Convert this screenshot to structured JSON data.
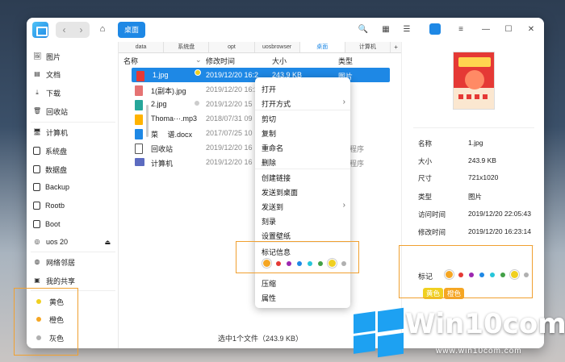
{
  "titlebar": {
    "back": "‹",
    "forward": "›",
    "home_icon": "home-icon",
    "crumb": "桌面",
    "search_icon": "🔍",
    "grid_icon": "▦",
    "list_icon": "☰",
    "menu_icon": "≡",
    "min": "—",
    "max": "☐",
    "close": "✕"
  },
  "sidebar": {
    "items": [
      {
        "label": "图片",
        "icon": "🖼"
      },
      {
        "label": "文档",
        "icon": "▤"
      },
      {
        "label": "下载",
        "icon": "⤓"
      },
      {
        "label": "回收站",
        "icon": "🗑"
      }
    ],
    "devices": [
      {
        "label": "计算机",
        "icon": "🖥"
      },
      {
        "label": "系统盘"
      },
      {
        "label": "数据盘"
      },
      {
        "label": "Backup"
      },
      {
        "label": "Rootb"
      },
      {
        "label": "Boot"
      },
      {
        "label": "uos 20",
        "eject": "⏏"
      }
    ],
    "network": [
      {
        "label": "网络邻居",
        "icon": "◍"
      },
      {
        "label": "我的共享",
        "icon": "▣"
      }
    ],
    "tags": [
      {
        "label": "黄色",
        "color": "#f0d020"
      },
      {
        "label": "橙色",
        "color": "#f5a623"
      },
      {
        "label": "灰色",
        "color": "#b0b0b0"
      }
    ]
  },
  "tabs": [
    "data",
    "系统盘",
    "opt",
    "uosbrowser",
    "桌面",
    "计算机"
  ],
  "tab_add": "+",
  "columns": {
    "name": "名称",
    "modified": "修改时间",
    "size": "大小",
    "type": "类型"
  },
  "files": [
    {
      "name": "1.jpg",
      "date": "2019/12/20 16:2",
      "size": "243.9 KB",
      "type": "图片",
      "color": "#e53935"
    },
    {
      "name": "1(副本).jpg",
      "date": "2019/12/20 16:2",
      "size": "",
      "type": "",
      "color": "#e57373"
    },
    {
      "name": "2.jpg",
      "date": "2019/12/20 15",
      "size": "",
      "type": "",
      "color": "#26a69a"
    },
    {
      "name": "Thoma···.mp3",
      "date": "2018/07/31 09",
      "size": "",
      "type": "",
      "color": "#ffb300"
    },
    {
      "name": "菜　 谱.docx",
      "date": "2017/07/25 10",
      "size": "",
      "type": "",
      "color": "#1e88e5"
    },
    {
      "name": "回收站",
      "date": "2019/12/20 16",
      "size": "",
      "type": "程序",
      "color": "#777777"
    },
    {
      "name": "计算机",
      "date": "2019/12/20 16",
      "size": "",
      "type": "程序",
      "color": "#5c6bc0"
    }
  ],
  "status": "选中1个文件（243.9 KB）",
  "context_menu": {
    "items": [
      "打开",
      "打开方式",
      "剪切",
      "复制",
      "重命名",
      "删除",
      "创建链接",
      "发送到桌面",
      "发送到",
      "刻录",
      "设置壁纸",
      "标记信息",
      "压缩",
      "属性"
    ],
    "arrow": "›"
  },
  "tag_colors": [
    "#f5a623",
    "#e53935",
    "#9c27b0",
    "#1e88e5",
    "#26c6da",
    "#43a047",
    "#f0d020",
    "#b0b0b0"
  ],
  "details": {
    "rows": [
      {
        "k": "名称",
        "v": "1.jpg"
      },
      {
        "k": "大小",
        "v": "243.9 KB"
      },
      {
        "k": "尺寸",
        "v": "721x1020"
      },
      {
        "k": "类型",
        "v": "图片"
      },
      {
        "k": "访问时间",
        "v": "2019/12/20 22:05:43"
      },
      {
        "k": "修改时间",
        "v": "2019/12/20 16:23:14"
      }
    ],
    "tag_label": "标记",
    "pills": [
      {
        "label": "黄色",
        "color": "#f0d020"
      },
      {
        "label": "橙色",
        "color": "#f5a623"
      }
    ]
  },
  "watermark": {
    "text": "Win10com",
    "sub": "www.win10com.com"
  }
}
